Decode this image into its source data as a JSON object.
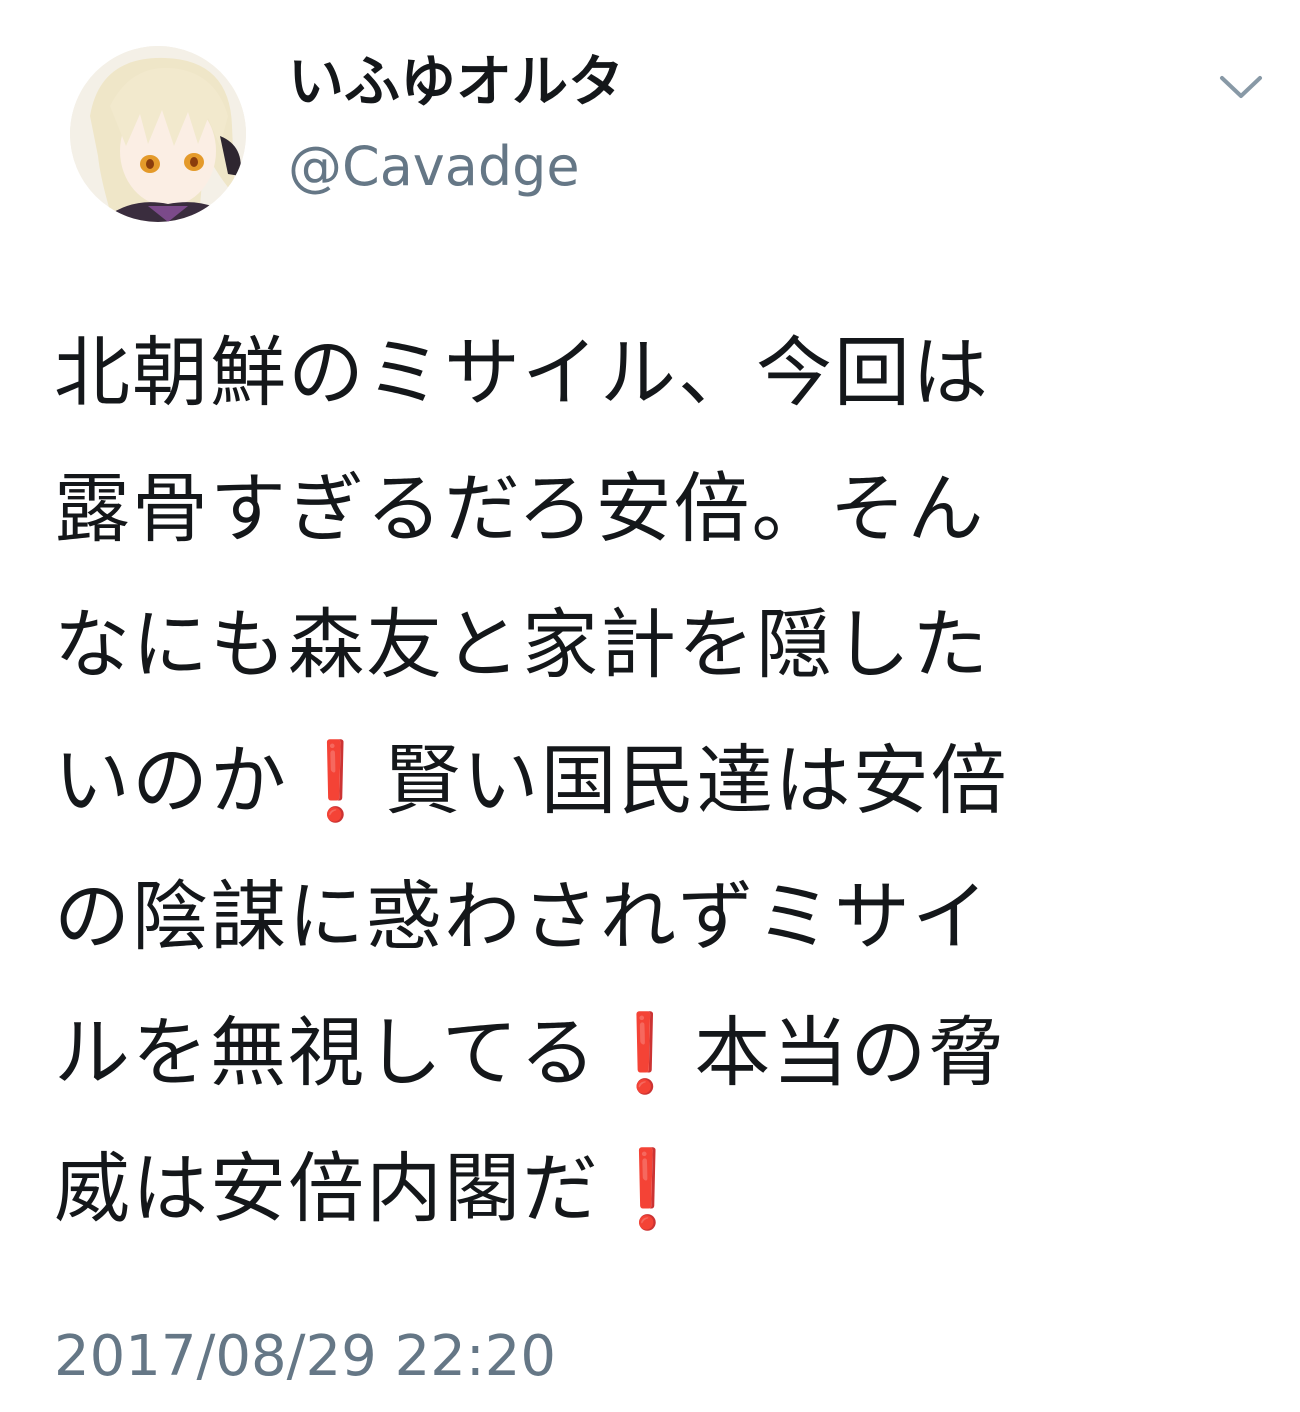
{
  "tweet": {
    "author": {
      "display_name": "いふゆオルタ",
      "handle": "@Cavadge",
      "avatar_icon": "anime-character-avatar"
    },
    "menu_icon": "chevron-down-icon",
    "text_lines": [
      {
        "parts": [
          "北朝鮮のミサイル、今回は"
        ]
      },
      {
        "parts": [
          "露骨すぎるだろ安倍。そん"
        ]
      },
      {
        "parts": [
          "なにも森友と家計を隠した"
        ]
      },
      {
        "parts": [
          "いのか",
          "❗",
          "賢い国民達は安倍"
        ]
      },
      {
        "parts": [
          "の陰謀に惑わされずミサイ"
        ]
      },
      {
        "parts": [
          "ルを無視してる",
          "❗",
          "本当の脅"
        ]
      },
      {
        "parts": [
          "威は安倍内閣だ",
          "❗"
        ]
      }
    ],
    "timestamp": "2017/08/29 22:20"
  },
  "colors": {
    "text": "#14171a",
    "secondary": "#657786",
    "exclamation": "#e0231e",
    "background": "#ffffff"
  }
}
